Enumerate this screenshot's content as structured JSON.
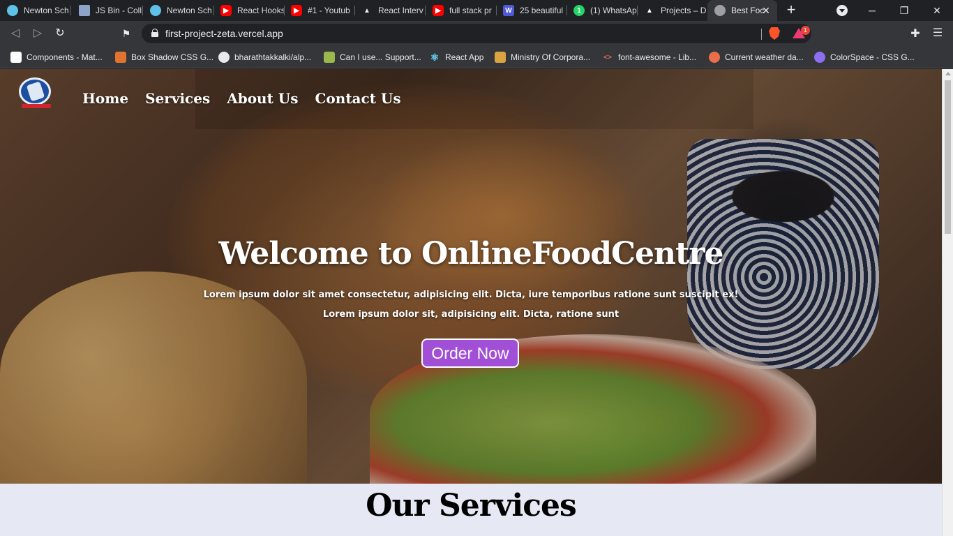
{
  "browser": {
    "tabs": [
      {
        "title": "Newton Sch",
        "icon": "newton-icon",
        "color": "#5ec1e8"
      },
      {
        "title": "JS Bin - Coll",
        "icon": "jsbin-icon",
        "color": "#8ca4c8"
      },
      {
        "title": "Newton Sch",
        "icon": "newton-icon",
        "color": "#5ec1e8"
      },
      {
        "title": "React Hooks",
        "icon": "youtube-icon",
        "color": "#ff0000"
      },
      {
        "title": "#1 - Youtub",
        "icon": "youtube-icon",
        "color": "#ff0000"
      },
      {
        "title": "React Interv",
        "icon": "mountain-icon",
        "color": "#e8eaed"
      },
      {
        "title": "full stack pr",
        "icon": "youtube-icon",
        "color": "#ff0000"
      },
      {
        "title": "25 beautiful",
        "icon": "w-icon",
        "color": "#4f5bd5",
        "letter": "W"
      },
      {
        "title": "(1) WhatsAp",
        "icon": "whatsapp-icon",
        "color": "#25d366",
        "letter": "1"
      },
      {
        "title": "Projects – D",
        "icon": "vercel-icon",
        "color": "#ffffff"
      },
      {
        "title": "Best Foc",
        "icon": "globe-icon",
        "color": "#9aa0a6",
        "active": true
      }
    ],
    "url": "first-project-zeta.vercel.app",
    "rewards_count": "1",
    "bookmarks": [
      {
        "title": "Components - Mat...",
        "color": "#ffffff"
      },
      {
        "title": "Box Shadow CSS G...",
        "color": "#e0742e"
      },
      {
        "title": "bharathtakkalki/alp...",
        "color": "#e8eaed"
      },
      {
        "title": "Can I use... Support...",
        "color": "#9ab84c"
      },
      {
        "title": "React App",
        "color": "#61dafb"
      },
      {
        "title": "Ministry Of Corpora...",
        "color": "#d9a441"
      },
      {
        "title": "font-awesome - Lib...",
        "color": "#e06c4a"
      },
      {
        "title": "Current weather da...",
        "color": "#eb6e4b"
      },
      {
        "title": "ColorSpace - CSS G...",
        "color": "#8e6ff0"
      }
    ]
  },
  "site": {
    "nav": [
      "Home",
      "Services",
      "About Us",
      "Contact Us"
    ],
    "hero_title": "Welcome to OnlineFoodCentre",
    "hero_line1": "Lorem ipsum dolor sit amet consectetur, adipisicing elit. Dicta, iure temporibus ratione sunt suscipit ex!",
    "hero_line2": "Lorem ipsum dolor sit, adipisicing elit. Dicta, ratione sunt",
    "order_button": "Order Now",
    "services_title": "Our Services",
    "accent": "#a14fd6"
  }
}
